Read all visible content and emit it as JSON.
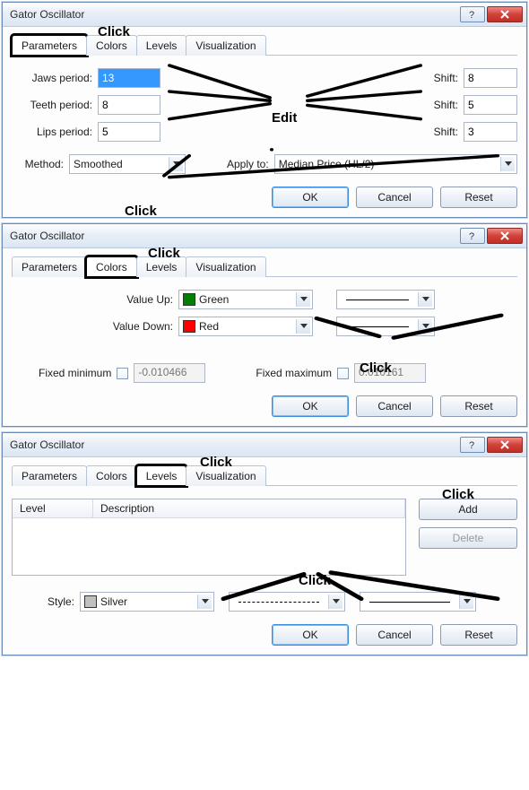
{
  "annotations": {
    "click": "Click",
    "edit": "Edit"
  },
  "dialog1": {
    "title": "Gator Oscillator",
    "tabs": [
      "Parameters",
      "Colors",
      "Levels",
      "Visualization"
    ],
    "jaws_label": "Jaws period:",
    "jaws_value": "13",
    "teeth_label": "Teeth period:",
    "teeth_value": "8",
    "lips_label": "Lips period:",
    "lips_value": "5",
    "shift_label": "Shift:",
    "shift_jaws": "8",
    "shift_teeth": "5",
    "shift_lips": "3",
    "method_label": "Method:",
    "method_value": "Smoothed",
    "applyto_label": "Apply to:",
    "applyto_value": "Median Price (HL/2)",
    "ok": "OK",
    "cancel": "Cancel",
    "reset": "Reset"
  },
  "dialog2": {
    "title": "Gator Oscillator",
    "tabs": [
      "Parameters",
      "Colors",
      "Levels",
      "Visualization"
    ],
    "valueup_label": "Value Up:",
    "valueup_color_name": "Green",
    "valueup_color": "#008000",
    "valuedown_label": "Value Down:",
    "valuedown_color_name": "Red",
    "valuedown_color": "#ff0000",
    "fixedmin_label": "Fixed minimum",
    "fixedmin_value": "-0.010466",
    "fixedmax_label": "Fixed maximum",
    "fixedmax_value": "0.010161",
    "ok": "OK",
    "cancel": "Cancel",
    "reset": "Reset"
  },
  "dialog3": {
    "title": "Gator Oscillator",
    "tabs": [
      "Parameters",
      "Colors",
      "Levels",
      "Visualization"
    ],
    "col_level": "Level",
    "col_desc": "Description",
    "add": "Add",
    "delete": "Delete",
    "style_label": "Style:",
    "style_color_name": "Silver",
    "style_color": "#c0c0c0",
    "ok": "OK",
    "cancel": "Cancel",
    "reset": "Reset"
  }
}
